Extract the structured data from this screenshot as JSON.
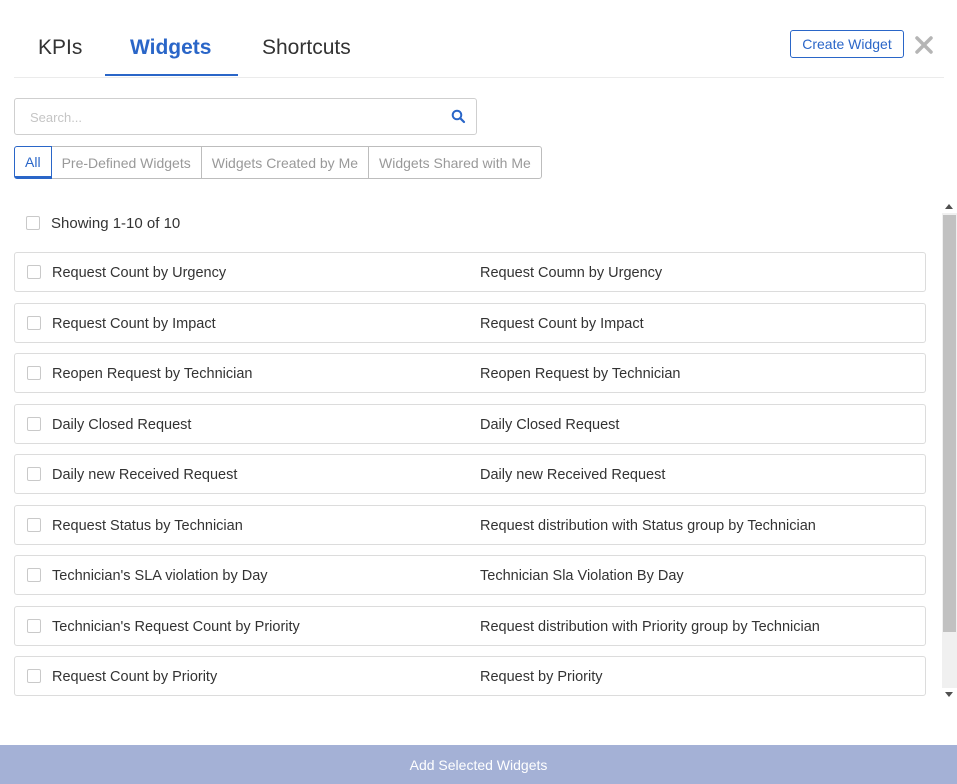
{
  "tabs": [
    {
      "label": "KPIs"
    },
    {
      "label": "Widgets"
    },
    {
      "label": "Shortcuts"
    }
  ],
  "active_tab": "Widgets",
  "create_button_label": "Create Widget",
  "search": {
    "placeholder": "Search...",
    "value": ""
  },
  "filters": [
    {
      "label": "All"
    },
    {
      "label": "Pre-Defined Widgets"
    },
    {
      "label": "Widgets Created by Me"
    },
    {
      "label": "Widgets Shared with Me"
    }
  ],
  "active_filter": "All",
  "showing_text": "Showing 1-10 of 10",
  "widgets": [
    {
      "name": "Request Count by Urgency",
      "description": "Request Coumn by Urgency"
    },
    {
      "name": "Request Count by Impact",
      "description": "Request Count by Impact"
    },
    {
      "name": "Reopen Request by Technician",
      "description": "Reopen Request by Technician"
    },
    {
      "name": "Daily Closed Request",
      "description": "Daily Closed Request"
    },
    {
      "name": "Daily new Received Request",
      "description": "Daily new Received Request"
    },
    {
      "name": "Request Status by Technician",
      "description": "Request distribution with Status group by Technician"
    },
    {
      "name": "Technician's SLA violation by Day",
      "description": "Technician Sla Violation By Day"
    },
    {
      "name": "Technician's Request Count by Priority",
      "description": "Request distribution with Priority group by Technician"
    },
    {
      "name": "Request Count by Priority",
      "description": "Request by Priority"
    }
  ],
  "footer_button_label": "Add Selected Widgets",
  "colors": {
    "accent": "#2a66c8",
    "footer": "#a4b1d6",
    "border": "#dcdcdc"
  },
  "icons": {
    "search": "search-icon",
    "close": "close-icon"
  }
}
